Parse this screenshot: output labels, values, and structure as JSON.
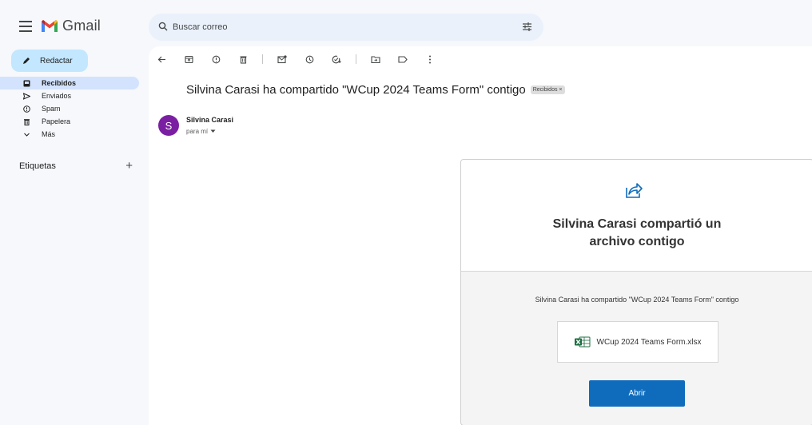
{
  "header": {
    "app_name": "Gmail",
    "search_placeholder": "Buscar correo"
  },
  "sidebar": {
    "compose_label": "Redactar",
    "items": [
      {
        "label": "Recibidos",
        "icon": "inbox-icon",
        "active": true
      },
      {
        "label": "Enviados",
        "icon": "send-icon",
        "active": false
      },
      {
        "label": "Spam",
        "icon": "spam-icon",
        "active": false
      },
      {
        "label": "Papelera",
        "icon": "trash-icon",
        "active": false
      },
      {
        "label": "Más",
        "icon": "chevron-down-icon",
        "active": false
      }
    ],
    "labels_heading": "Etiquetas"
  },
  "email": {
    "subject": "Silvina Carasi ha compartido \"WCup 2024 Teams Form\" contigo",
    "badge": "Recibidos ×",
    "sender_initial": "S",
    "sender_name": "Silvina Carasi",
    "to_line": "para mí"
  },
  "share_card": {
    "title_line1": "Silvina Carasi compartió un",
    "title_line2": "archivo contigo",
    "message": "Silvina Carasi ha compartido \"WCup 2024 Teams Form\" contigo",
    "file_name": "WCup 2024 Teams Form.xlsx",
    "open_label": "Abrir"
  },
  "colors": {
    "background": "#f6f8fc",
    "compose": "#c2e7ff",
    "active_nav": "#d3e3fd",
    "search": "#eaf1fb",
    "avatar": "#7b1fa2",
    "open_button": "#0f6cbd",
    "excel_green": "#1d6f42"
  }
}
